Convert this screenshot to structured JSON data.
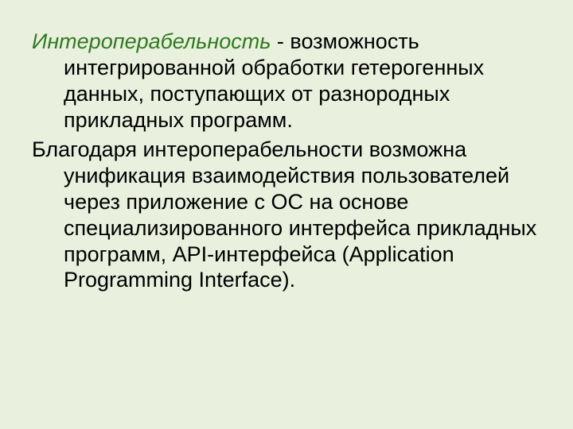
{
  "slide": {
    "paragraphs": [
      {
        "term": "Интероперабельность",
        "rest": " - возможность интегрированной обработки гетерогенных данных, поступающих от разнородных прикладных программ."
      },
      {
        "text": "Благодаря интероперабельности возможна унификация взаимодействия пользователей через приложение с ОС на основе специализированного интерфейса прикладных программ, API-интерфейса (Application Programming Interface)."
      }
    ]
  }
}
